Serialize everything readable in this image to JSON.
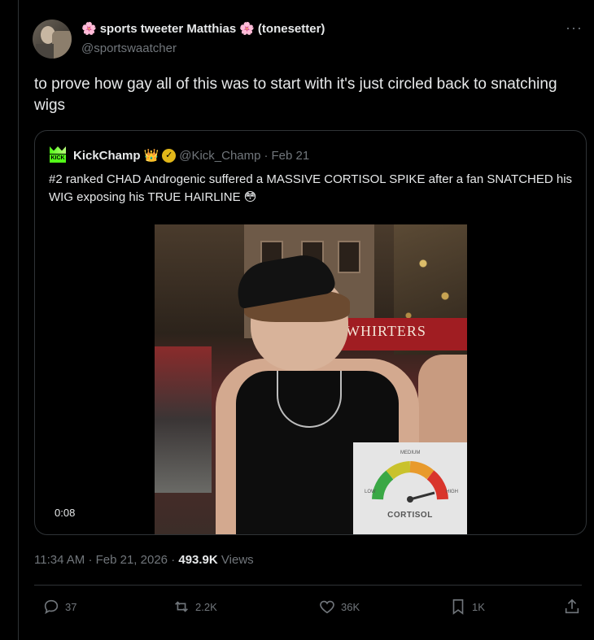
{
  "author": {
    "flower_left": "🌸",
    "name": "sports tweeter Matthias",
    "flower_right": "🌸",
    "suffix": "(tonesetter)",
    "handle": "@sportswaatcher"
  },
  "menu_label": "···",
  "tweet_text": "to prove how gay all of this was to start with it's just circled back to snatching wigs",
  "quote": {
    "name": "KickChamp",
    "crown": "👑",
    "verified_mark": "✓",
    "avatar_text": "KICK",
    "handle": "@Kick_Champ",
    "separator": "·",
    "date": "Feb 21",
    "text": "#2 ranked CHAD Androgenic suffered a MASSIVE CORTISOL SPIKE after a fan SNATCHED his WIG exposing his TRUE HAIRLINE 😳",
    "media": {
      "timer": "0:08",
      "sign_text": "WHIRTERS",
      "gauge_label": "CORTISOL",
      "gauge_low": "LOW",
      "gauge_medium": "MEDIUM",
      "gauge_high": "HIGH"
    }
  },
  "meta": {
    "time": "11:34 AM",
    "sep1": "·",
    "date": "Feb 21, 2026",
    "sep2": "·",
    "views_count": "493.9K",
    "views_label": "Views"
  },
  "actions": {
    "replies": "37",
    "reposts": "2.2K",
    "likes": "36K",
    "bookmarks": "1K"
  },
  "colors": {
    "background": "#000000",
    "text": "#e7e9ea",
    "muted": "#71767b",
    "border": "#2f3336",
    "verified_gold": "#e2b719",
    "kick_green": "#53fc18"
  }
}
